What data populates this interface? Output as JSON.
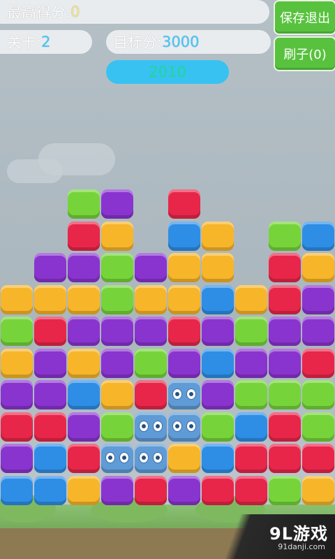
{
  "header": {
    "best_label": "最高得分:",
    "best_value": "0",
    "level_label": "关卡:",
    "level_value": "2",
    "target_label": "目标分:",
    "target_value": "3000",
    "current_score": "2010"
  },
  "buttons": {
    "save_exit": "保存退出",
    "brush": "刷子(0)"
  },
  "colors": {
    "G": "#76d43a",
    "P": "#8a34cf",
    "R": "#e8264a",
    "B": "#2e8ee6",
    "O": "#f7b52a",
    "F": "#5f9bd6"
  },
  "board": {
    "columns": 10,
    "rows": [
      [
        "_",
        "_",
        "G",
        "P",
        "_",
        "R",
        "_",
        "_",
        "_",
        "_"
      ],
      [
        "_",
        "_",
        "R",
        "O",
        "_",
        "B",
        "O",
        "_",
        "G",
        "B"
      ],
      [
        "_",
        "P",
        "P",
        "G",
        "P",
        "O",
        "O",
        "_",
        "R",
        "O"
      ],
      [
        "O",
        "O",
        "O",
        "G",
        "O",
        "O",
        "B",
        "O",
        "R",
        "P"
      ],
      [
        "G",
        "R",
        "P",
        "P",
        "P",
        "R",
        "P",
        "G",
        "P",
        "P"
      ],
      [
        "O",
        "P",
        "O",
        "P",
        "G",
        "P",
        "B",
        "P",
        "P",
        "R"
      ],
      [
        "P",
        "P",
        "B",
        "O",
        "R",
        "F",
        "P",
        "G",
        "G",
        "G"
      ],
      [
        "R",
        "R",
        "P",
        "G",
        "F",
        "F",
        "G",
        "B",
        "R",
        "G"
      ],
      [
        "P",
        "B",
        "R",
        "F",
        "F",
        "O",
        "B",
        "R",
        "R",
        "R"
      ],
      [
        "B",
        "B",
        "O",
        "P",
        "R",
        "P",
        "R",
        "R",
        "G",
        "O"
      ]
    ]
  },
  "watermark": {
    "logo": "9L游戏",
    "site": "91danji.com"
  }
}
